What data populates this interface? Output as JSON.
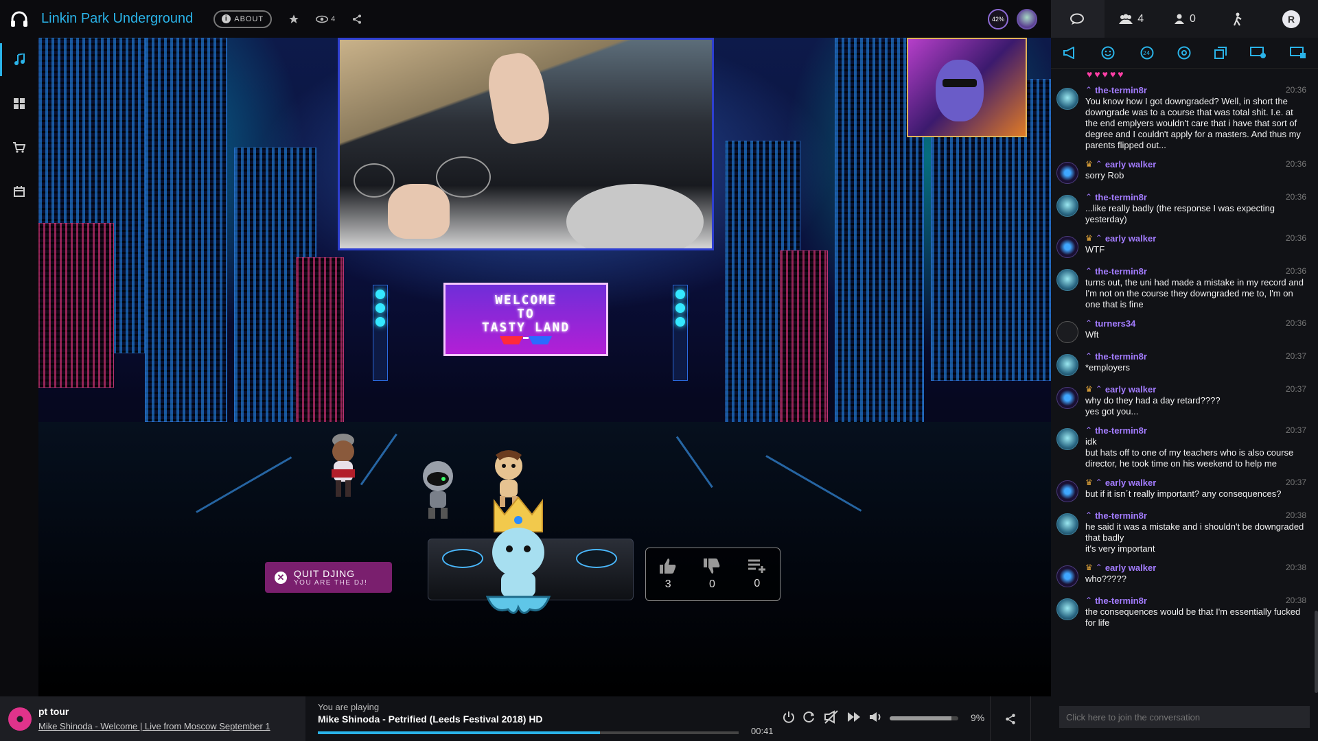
{
  "header": {
    "room_title": "Linkin Park Underground",
    "about_label": "ABOUT",
    "viewers": "4",
    "progress_badge": "42%"
  },
  "right_tabs": {
    "users_count": "4",
    "waitlist_count": "0"
  },
  "stage": {
    "welcome_lines": [
      "WELCOME",
      "TO",
      "TASTY LAND"
    ],
    "quit_dj_label": "QUIT DJING",
    "quit_dj_sub": "YOU ARE THE DJ!",
    "votes": {
      "woot": "3",
      "meh": "0",
      "grab": "0"
    }
  },
  "chat": {
    "hearts": "♥♥♥♥♥",
    "messages": [
      {
        "user": "the-termin8r",
        "avatar": "t8",
        "crown": false,
        "time": "20:36",
        "text": "You know how I got downgraded? Well, in short the downgrade was to a course that was total shit. I.e. at the end emplyers wouldn't care that i have that sort of degree and I couldn't apply for a masters. And thus my parents flipped out..."
      },
      {
        "user": "early walker",
        "avatar": "ew",
        "crown": true,
        "time": "20:36",
        "text": "sorry Rob"
      },
      {
        "user": "the-termin8r",
        "avatar": "t8",
        "crown": false,
        "time": "20:36",
        "text": "...like really badly (the response I was expecting yesterday)"
      },
      {
        "user": "early walker",
        "avatar": "ew",
        "crown": true,
        "time": "20:36",
        "text": "WTF"
      },
      {
        "user": "the-termin8r",
        "avatar": "t8",
        "crown": false,
        "time": "20:36",
        "text": "turns out, the uni had made a mistake in my record and I'm not on the course they downgraded me to, I'm on one that is fine"
      },
      {
        "user": "turners34",
        "avatar": "tu",
        "crown": false,
        "time": "20:36",
        "text": "Wft"
      },
      {
        "user": "the-termin8r",
        "avatar": "t8",
        "crown": false,
        "time": "20:37",
        "text": "*employers"
      },
      {
        "user": "early walker",
        "avatar": "ew",
        "crown": true,
        "time": "20:37",
        "text": "why do they had a day retard????\nyes got you..."
      },
      {
        "user": "the-termin8r",
        "avatar": "t8",
        "crown": false,
        "time": "20:37",
        "text": "idk\nbut hats off to one of my teachers who is also course director, he took time on his weekend to help me"
      },
      {
        "user": "early walker",
        "avatar": "ew",
        "crown": true,
        "time": "20:37",
        "text": "but if it isn´t really important? any consequences?"
      },
      {
        "user": "the-termin8r",
        "avatar": "t8",
        "crown": false,
        "time": "20:38",
        "text": "he said it was a mistake and i shouldn't be downgraded that badly\nit's very important"
      },
      {
        "user": "early walker",
        "avatar": "ew",
        "crown": true,
        "time": "20:38",
        "text": "who?????"
      },
      {
        "user": "the-termin8r",
        "avatar": "t8",
        "crown": false,
        "time": "20:38",
        "text": "the consequences would be that I'm essentially fucked for life"
      }
    ],
    "input_placeholder": "Click here to join the conversation"
  },
  "bottom": {
    "playlist_name": "pt tour",
    "playlist_next": "Mike Shinoda - Welcome | Live from Moscow September 1",
    "now_playing_label": "You are playing",
    "now_playing_song": "Mike Shinoda - Petrified (Leeds Festival 2018) HD",
    "elapsed": "00:41",
    "progress_fraction": 0.67,
    "volume_label": "9%",
    "volume_fraction": 0.9
  },
  "colors": {
    "accent": "#2ab3e8",
    "username": "#a37cff",
    "quit_dj_bg": "#7a1f6e"
  }
}
